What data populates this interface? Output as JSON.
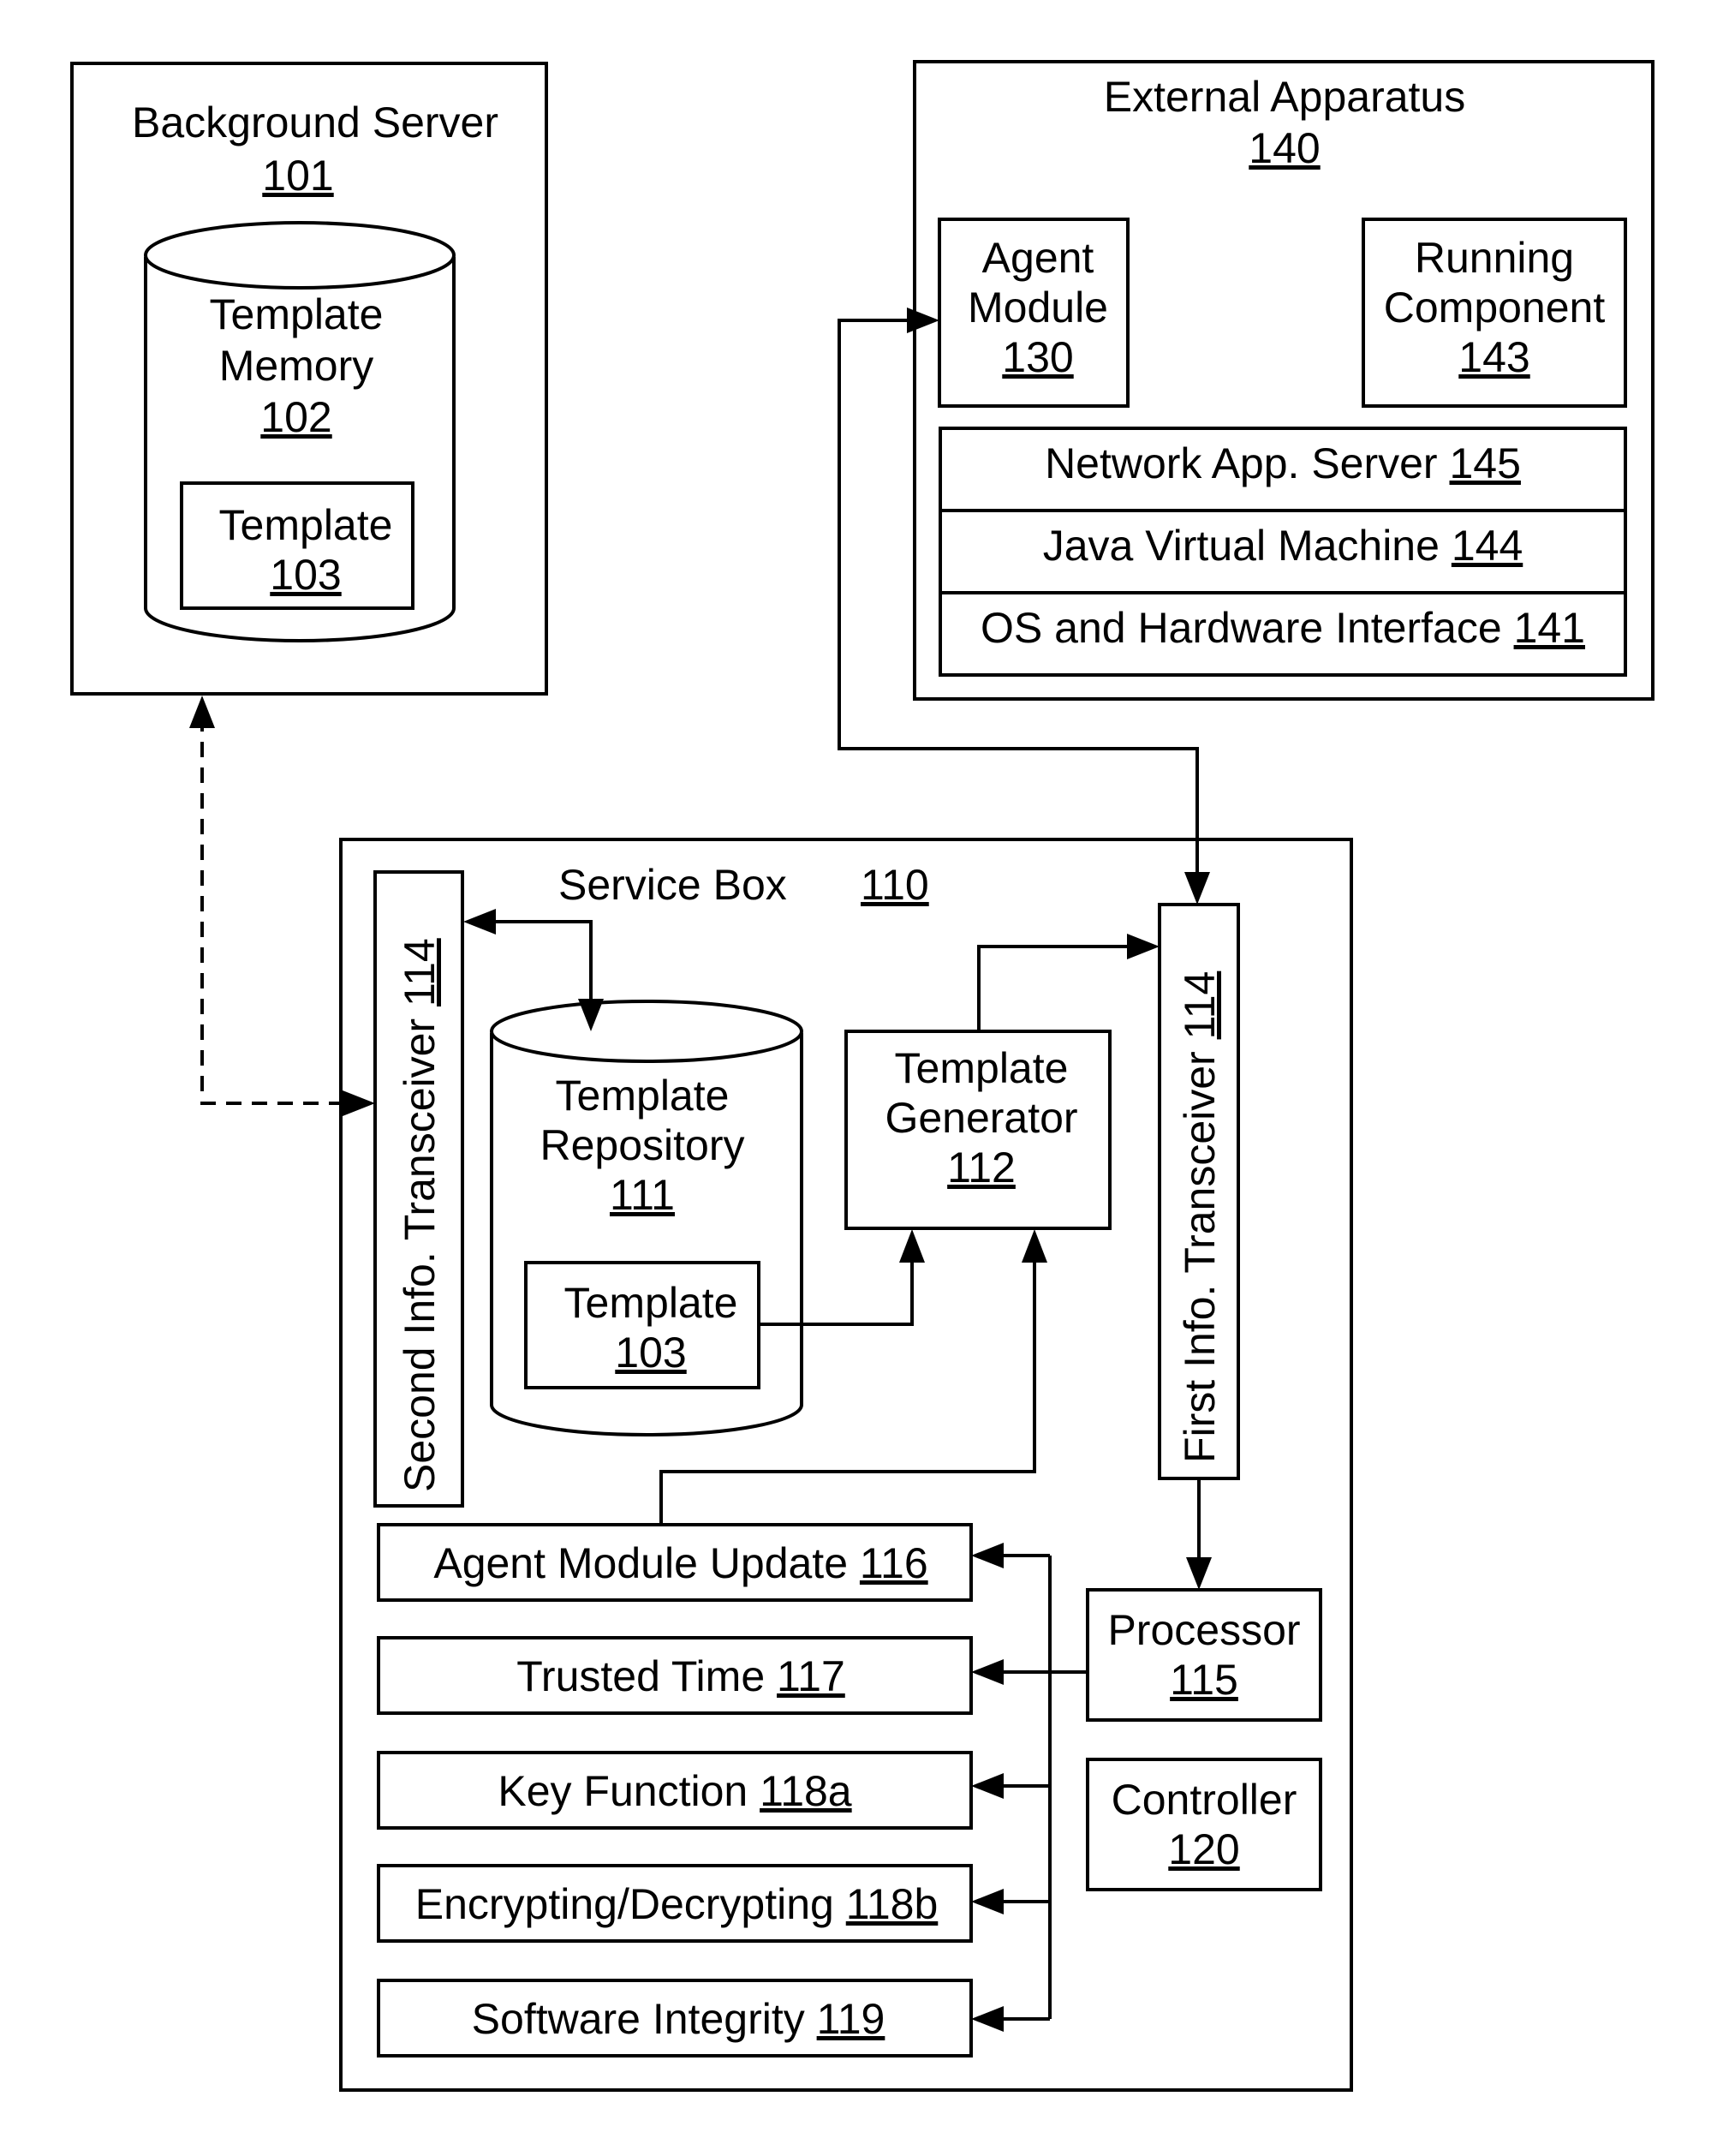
{
  "diagram": {
    "background_server": {
      "title": "Background Server",
      "ref": "101"
    },
    "template_memory": {
      "line1": "Template",
      "line2": "Memory",
      "ref": "102"
    },
    "template_in_memory": {
      "title": "Template",
      "ref": "103"
    },
    "external_apparatus": {
      "title": "External Apparatus",
      "ref": "140"
    },
    "agent_module": {
      "line1": "Agent",
      "line2": "Module",
      "ref": "130"
    },
    "running_component": {
      "line1": "Running",
      "line2": "Component",
      "ref": "143"
    },
    "stack_layers": [
      {
        "label": "Network App. Server",
        "ref": "145"
      },
      {
        "label": "Java Virtual Machine",
        "ref": "144"
      },
      {
        "label": "OS and Hardware Interface",
        "ref": "141"
      }
    ],
    "service_box": {
      "title": "Service Box",
      "ref": "110"
    },
    "second_transceiver": {
      "label": "Second Info. Transceiver",
      "ref": "114"
    },
    "first_transceiver": {
      "label": "First Info. Transceiver",
      "ref": "114"
    },
    "template_repository": {
      "line1": "Template",
      "line2": "Repository",
      "ref": "111"
    },
    "template_in_repository": {
      "title": "Template",
      "ref": "103"
    },
    "template_generator": {
      "line1": "Template",
      "line2": "Generator",
      "ref": "112"
    },
    "function_modules": [
      {
        "label": "Agent Module Update",
        "ref": "116"
      },
      {
        "label": "Trusted Time",
        "ref": "117"
      },
      {
        "label": "Key Function",
        "ref": "118a"
      },
      {
        "label": "Encrypting/Decrypting",
        "ref": "118b"
      },
      {
        "label": "Software Integrity",
        "ref": "119"
      }
    ],
    "processor": {
      "title": "Processor",
      "ref": "115"
    },
    "controller": {
      "title": "Controller",
      "ref": "120"
    }
  }
}
